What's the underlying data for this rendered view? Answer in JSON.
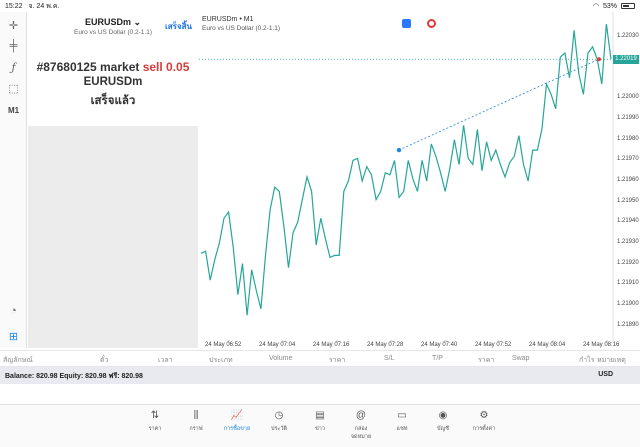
{
  "status_bar": {
    "time": "15:22",
    "date": "จ. 24 พ.ค.",
    "battery": "53%",
    "battery_level": 0.53
  },
  "symbol_panel": {
    "symbol": "EURUSDm",
    "description": "Euro vs US Dollar (0.2-1.1)",
    "done_label": "เสร็จสิ้น",
    "order_id": "#87680125",
    "order_type": "market",
    "order_side": "sell 0.05",
    "order_symbol": "EURUSDm",
    "order_status": "เสร็จแล้ว"
  },
  "left_toolbar": {
    "timeframe": "M1"
  },
  "chart": {
    "title": "EURUSDm • M1",
    "subtitle": "Euro vs US Dollar (0.2-1.1)",
    "current_price": "1.22019",
    "line_color": "#26a69a",
    "order_line_color": "#1e88e5"
  },
  "chart_data": {
    "type": "line",
    "title": "EURUSDm • M1",
    "y_ticks": [
      "1.22030",
      "1.22019",
      "1.22000",
      "1.21990",
      "1.21980",
      "1.21970",
      "1.21960",
      "1.21950",
      "1.21940",
      "1.21930",
      "1.21920",
      "1.21910",
      "1.21900",
      "1.21890"
    ],
    "x_ticks": [
      "24 May 06:52",
      "24 May 07:04",
      "24 May 07:16",
      "24 May 07:28",
      "24 May 07:40",
      "24 May 07:52",
      "24 May 08:04",
      "24 May 08:16"
    ],
    "ylim": [
      1.21883,
      1.22038
    ],
    "values": [
      1.21925,
      1.21926,
      1.21912,
      1.21922,
      1.2193,
      1.21942,
      1.21945,
      1.21928,
      1.21905,
      1.2192,
      1.21895,
      1.21917,
      1.21907,
      1.21898,
      1.21924,
      1.21946,
      1.21957,
      1.21955,
      1.21938,
      1.21918,
      1.21935,
      1.2194,
      1.21951,
      1.21962,
      1.21955,
      1.21929,
      1.21942,
      1.21932,
      1.21923,
      1.21924,
      1.21924,
      1.21955,
      1.2196,
      1.2197,
      1.21971,
      1.2196,
      1.21967,
      1.21963,
      1.21951,
      1.21955,
      1.21964,
      1.21963,
      1.2197,
      1.21952,
      1.21955,
      1.2197,
      1.21961,
      1.21955,
      1.2197,
      1.2196,
      1.21978,
      1.21972,
      1.21964,
      1.21955,
      1.21966,
      1.2198,
      1.21968,
      1.21987,
      1.21971,
      1.21968,
      1.21985,
      1.21965,
      1.21979,
      1.2197,
      1.21975,
      1.21968,
      1.21962,
      1.21969,
      1.21972,
      1.21982,
      1.21968,
      1.2196,
      1.21975,
      1.21975,
      1.21985,
      1.22007,
      1.22002,
      1.21995,
      1.2202,
      1.22022,
      1.2201,
      1.22033,
      1.22012,
      1.22002,
      1.22022,
      1.22025,
      1.22019,
      1.22007,
      1.22036,
      1.22019
    ],
    "order_line": {
      "start": 1.21975,
      "end": 1.22019
    }
  },
  "columns": [
    "สัญลักษณ์",
    "ตั๋ว",
    "เวลา",
    "ประเภท",
    "Volume",
    "ราคา",
    "S/L",
    "T/P",
    "ราคา",
    "Swap",
    "กำไร",
    "หมายเหตุ"
  ],
  "balance": {
    "text": "Balance: 820.98 Equity: 820.98 ฟรี: 820.98",
    "currency": "USD"
  },
  "tabs": [
    {
      "label": "ราคา",
      "icon": "⇅"
    },
    {
      "label": "กราฟ",
      "icon": "⫼"
    },
    {
      "label": "การซื้อขาย",
      "icon": "📈"
    },
    {
      "label": "ประวัติ",
      "icon": "◷"
    },
    {
      "label": "ข่าว",
      "icon": "▤"
    },
    {
      "label": "กล่องจดหมาย",
      "icon": "@"
    },
    {
      "label": "แชท",
      "icon": "▭"
    },
    {
      "label": "บัญชี",
      "icon": "◉"
    },
    {
      "label": "การตั้งค่า",
      "icon": "⚙"
    }
  ]
}
